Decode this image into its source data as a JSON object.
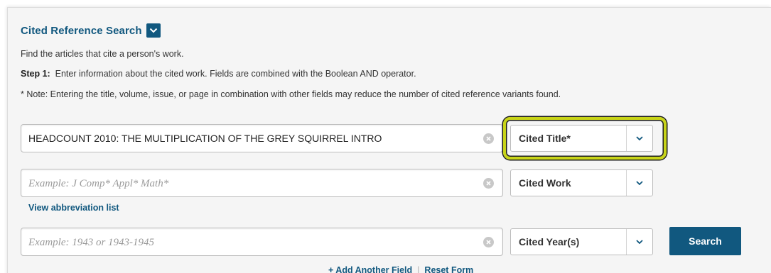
{
  "header": {
    "title": "Cited Reference Search",
    "toggle_icon": "chevron-down-icon"
  },
  "intro": {
    "description": "Find the articles that cite a person's work.",
    "step_label": "Step 1:",
    "step_text": "Enter information about the cited work. Fields are combined with the Boolean AND operator.",
    "note": "* Note: Entering the title, volume, issue, or page in combination with other fields may reduce the number of cited reference variants found."
  },
  "fields": [
    {
      "value": "HEADCOUNT 2010: THE MULTIPLICATION OF THE GREY SQUIRREL INTRO",
      "placeholder": "",
      "select_label": "Cited Title*"
    },
    {
      "value": "",
      "placeholder": "Example: J Comp* Appl* Math*",
      "select_label": "Cited Work"
    },
    {
      "value": "",
      "placeholder": "Example: 1943 or 1943-1945",
      "select_label": "Cited Year(s)"
    }
  ],
  "links": {
    "abbreviation_list": "View abbreviation list",
    "add_field": "+ Add Another Field",
    "separator": "|",
    "reset_form": "Reset Form"
  },
  "search_button": "Search",
  "colors": {
    "brand": "#11587f",
    "highlight": "#c8d418",
    "panel_bg": "#f5f5f5"
  }
}
